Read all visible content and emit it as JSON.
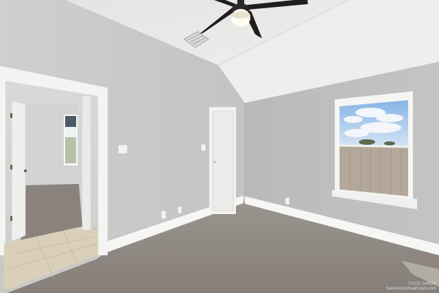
{
  "photo": {
    "subject": "empty-bedroom-interior",
    "colors": {
      "wall_left": "#c6c7c5",
      "wall_right": "#bebfbd",
      "ceiling": "#e9e9e8",
      "carpet": "#8e8782",
      "trim": "#f7f7f5",
      "tile": "#d8cdb5",
      "sky": "#9ec3ea"
    }
  },
  "watermark": {
    "copyright": "©2025 SABOR",
    "site": "SanAntonioRealEstate.com"
  }
}
